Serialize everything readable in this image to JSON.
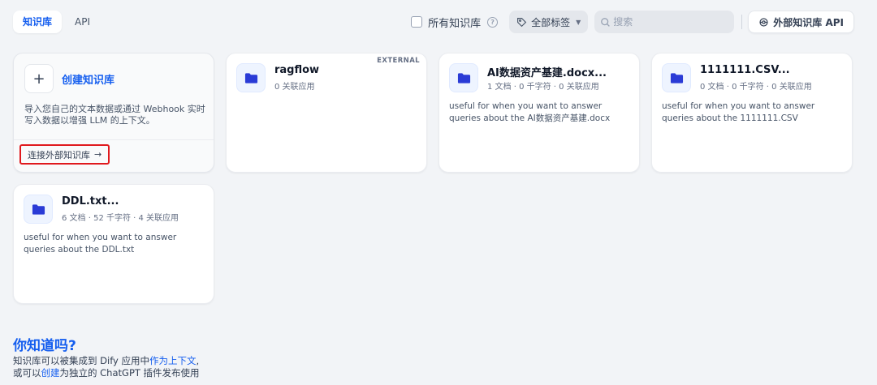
{
  "tabs": [
    {
      "label": "知识库",
      "active": true
    },
    {
      "label": "API",
      "active": false
    }
  ],
  "filters": {
    "all_kb_label": "所有知识库",
    "tag_label": "全部标签",
    "search_placeholder": "搜索",
    "external_api_label": "外部知识库 API"
  },
  "create_card": {
    "title": "创建知识库",
    "description": "导入您自己的文本数据或通过 Webhook 实时写入数据以增强 LLM 的上下文。",
    "connect_label": "连接外部知识库",
    "connect_arrow": "→"
  },
  "knowledge_bases": [
    {
      "name": "ragflow",
      "meta": "0 关联应用",
      "badge": "EXTERNAL",
      "description": ""
    },
    {
      "name": "AI数据资产基建.docx...",
      "meta": "1 文档 · 0 千字符 · 0 关联应用",
      "badge": "",
      "description": "useful for when you want to answer queries about the AI数据资产基建.docx"
    },
    {
      "name": "1111111.CSV...",
      "meta": "0 文档 · 0 千字符 · 0 关联应用",
      "badge": "",
      "description": "useful for when you want to answer queries about the 1111111.CSV"
    },
    {
      "name": "DDL.txt...",
      "meta": "6 文档 · 52 千字符 · 4 关联应用",
      "badge": "",
      "description": "useful for when you want to answer queries about the DDL.txt"
    }
  ],
  "tip": {
    "title": "你知道吗?",
    "line1_prefix": "知识库可以被集成到 Dify 应用中",
    "line1_link": "作为上下文",
    "line1_suffix": ",",
    "line2_prefix": "或可以",
    "line2_link": "创建",
    "line2_suffix": "为独立的 ChatGPT 插件发布使用"
  },
  "colors": {
    "accent": "#155eef",
    "highlight_border": "#e0191d",
    "folder_icon": "#2a3bd6",
    "background": "#f2f4f7"
  },
  "icons": [
    "plus-icon",
    "folder-icon",
    "help-icon",
    "tag-icon",
    "chevron-down-icon",
    "search-icon",
    "api-icon",
    "arrow-right-icon"
  ]
}
